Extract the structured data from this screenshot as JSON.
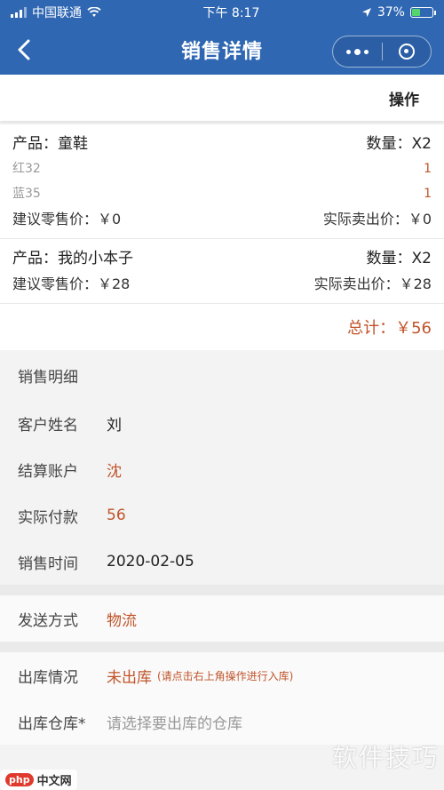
{
  "status_bar": {
    "carrier": "中国联通",
    "time": "下午 8:17",
    "battery": "37%"
  },
  "nav": {
    "title": "销售详情"
  },
  "toolbar": {
    "action_label": "操作"
  },
  "products": [
    {
      "name": "产品：童鞋",
      "quantity": "数量：X2",
      "variants": [
        {
          "name": "红32",
          "qty": "1"
        },
        {
          "name": "蓝35",
          "qty": "1"
        }
      ],
      "suggested_price": "建议零售价：￥0",
      "actual_price": "实际卖出价：￥0"
    },
    {
      "name": "产品：我的小本子",
      "quantity": "数量：X2",
      "variants": [],
      "suggested_price": "建议零售价：￥28",
      "actual_price": "实际卖出价：￥28"
    }
  ],
  "total": "总计：￥56",
  "details": {
    "section_title": "销售明细",
    "customer_label": "客户姓名",
    "customer_value": "刘",
    "account_label": "结算账户",
    "account_value": "沈",
    "payment_label": "实际付款",
    "payment_value": "56",
    "time_label": "销售时间",
    "time_value": "2020-02-05"
  },
  "shipping": {
    "label": "发送方式",
    "value": "物流"
  },
  "warehouse": {
    "status_label": "出库情况",
    "status_value": "未出库",
    "status_hint": "(请点击右上角操作进行入库)",
    "store_label": "出库仓库*",
    "store_placeholder": "请选择要出库的仓库"
  },
  "watermarks": {
    "site": "软件技巧",
    "php_badge": "php",
    "php_cn": "中文网"
  },
  "colors": {
    "primary": "#2f67b3",
    "accent": "#c0542a"
  }
}
